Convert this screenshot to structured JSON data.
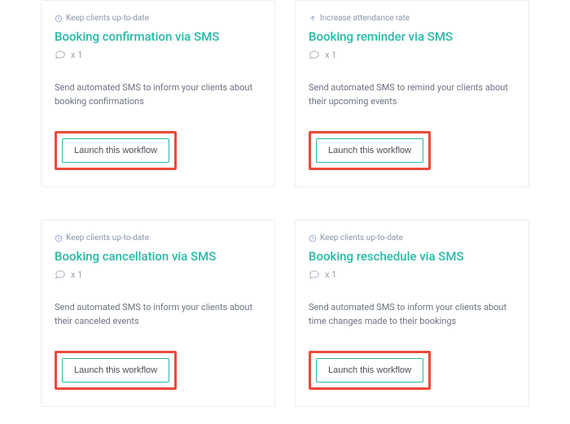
{
  "cards": [
    {
      "tag_icon": "clock",
      "tag_label": "Keep clients up-to-date",
      "title": "Booking confirmation via SMS",
      "count_label": "x 1",
      "description": "Send automated SMS to inform your clients about booking confirmations",
      "button_label": "Launch this workflow"
    },
    {
      "tag_icon": "arrow-up",
      "tag_label": "Increase attendance rate",
      "title": "Booking reminder via SMS",
      "count_label": "x 1",
      "description": "Send automated SMS to remind your clients about their upcoming events",
      "button_label": "Launch this workflow"
    },
    {
      "tag_icon": "clock",
      "tag_label": "Keep clients up-to-date",
      "title": "Booking cancellation via SMS",
      "count_label": "x 1",
      "description": "Send automated SMS to inform your clients about their canceled events",
      "button_label": "Launch this workflow"
    },
    {
      "tag_icon": "clock",
      "tag_label": "Keep clients up-to-date",
      "title": "Booking reschedule via SMS",
      "count_label": "x 1",
      "description": "Send automated SMS to inform your clients about time changes made to their bookings",
      "button_label": "Launch this workflow"
    }
  ]
}
